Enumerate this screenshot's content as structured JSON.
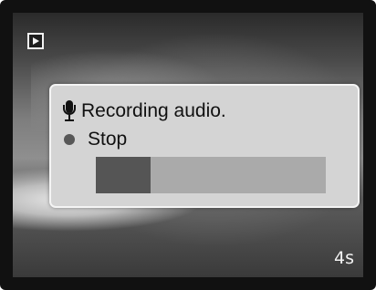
{
  "screen": {
    "mode_icon": "play-icon",
    "timer": "4s"
  },
  "dialog": {
    "recording_label": "Recording audio.",
    "recording_icon": "microphone-icon",
    "stop_label": "Stop",
    "stop_icon": "dot-icon",
    "progress_fraction": 0.24
  },
  "colors": {
    "dialog_bg": "#d4d4d4",
    "progress_fill": "#555555",
    "progress_track": "#aaaaaa"
  }
}
